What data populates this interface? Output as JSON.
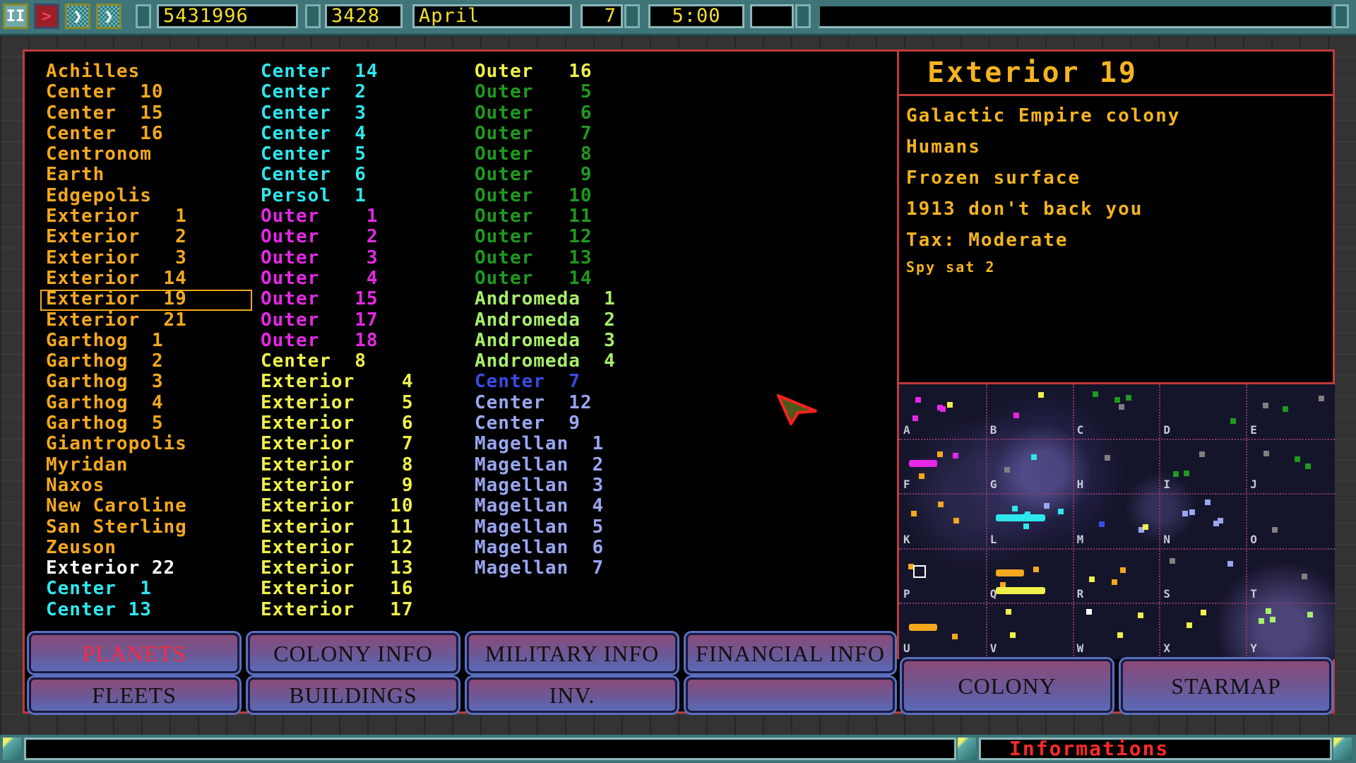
{
  "topbar": {
    "controls": [
      {
        "name": "pause",
        "glyph": "II"
      },
      {
        "name": "play",
        "glyph": ">"
      },
      {
        "name": "fast",
        "glyph": "❯"
      },
      {
        "name": "faster",
        "glyph": "❯"
      }
    ],
    "credits": "5431996",
    "population": "3428",
    "month": "April",
    "day": "7",
    "time": "5:00",
    "empty_field": "",
    "message": ""
  },
  "planet_list": {
    "selected": "Exterior 19",
    "columns": [
      [
        {
          "name": "Achilles",
          "color": "#f5a81e"
        },
        {
          "name": "Center  10",
          "color": "#f5a81e"
        },
        {
          "name": "Center  15",
          "color": "#f5a81e"
        },
        {
          "name": "Center  16",
          "color": "#f5a81e"
        },
        {
          "name": "Centronom",
          "color": "#f5a81e"
        },
        {
          "name": "Earth",
          "color": "#f5a81e"
        },
        {
          "name": "Edgepolis",
          "color": "#f5a81e"
        },
        {
          "name": "Exterior   1",
          "color": "#f5a81e"
        },
        {
          "name": "Exterior   2",
          "color": "#f5a81e"
        },
        {
          "name": "Exterior   3",
          "color": "#f5a81e"
        },
        {
          "name": "Exterior  14",
          "color": "#f5a81e"
        },
        {
          "name": "Exterior  19",
          "color": "#f5a81e",
          "selected": true
        },
        {
          "name": "Exterior  21",
          "color": "#f5a81e"
        },
        {
          "name": "Garthog  1",
          "color": "#f5a81e"
        },
        {
          "name": "Garthog  2",
          "color": "#f5a81e"
        },
        {
          "name": "Garthog  3",
          "color": "#f5a81e"
        },
        {
          "name": "Garthog  4",
          "color": "#f5a81e"
        },
        {
          "name": "Garthog  5",
          "color": "#f5a81e"
        },
        {
          "name": "Giantropolis",
          "color": "#f5a81e"
        },
        {
          "name": "Myridan",
          "color": "#f5a81e"
        },
        {
          "name": "Naxos",
          "color": "#f5a81e"
        },
        {
          "name": "New Caroline",
          "color": "#f5a81e"
        },
        {
          "name": "San Sterling",
          "color": "#f5a81e"
        },
        {
          "name": "Zeuson",
          "color": "#f5a81e"
        },
        {
          "name": "Exterior 22",
          "color": "#ffffff"
        },
        {
          "name": "Center  1",
          "color": "#2ee6ee"
        },
        {
          "name": "Center 13",
          "color": "#2ee6ee"
        }
      ],
      [
        {
          "name": "Center  14",
          "color": "#2ee6ee"
        },
        {
          "name": "Center  2",
          "color": "#2ee6ee"
        },
        {
          "name": "Center  3",
          "color": "#2ee6ee"
        },
        {
          "name": "Center  4",
          "color": "#2ee6ee"
        },
        {
          "name": "Center  5",
          "color": "#2ee6ee"
        },
        {
          "name": "Center  6",
          "color": "#2ee6ee"
        },
        {
          "name": "Persol  1",
          "color": "#2ee6ee"
        },
        {
          "name": "Outer    1",
          "color": "#e628e6"
        },
        {
          "name": "Outer    2",
          "color": "#e628e6"
        },
        {
          "name": "Outer    3",
          "color": "#e628e6"
        },
        {
          "name": "Outer    4",
          "color": "#e628e6"
        },
        {
          "name": "Outer   15",
          "color": "#e628e6"
        },
        {
          "name": "Outer   17",
          "color": "#e628e6"
        },
        {
          "name": "Outer   18",
          "color": "#e628e6"
        },
        {
          "name": "Center  8",
          "color": "#f0f04a"
        },
        {
          "name": "Exterior    4",
          "color": "#f0f04a"
        },
        {
          "name": "Exterior    5",
          "color": "#f0f04a"
        },
        {
          "name": "Exterior    6",
          "color": "#f0f04a"
        },
        {
          "name": "Exterior    7",
          "color": "#f0f04a"
        },
        {
          "name": "Exterior    8",
          "color": "#f0f04a"
        },
        {
          "name": "Exterior    9",
          "color": "#f0f04a"
        },
        {
          "name": "Exterior   10",
          "color": "#f0f04a"
        },
        {
          "name": "Exterior   11",
          "color": "#f0f04a"
        },
        {
          "name": "Exterior   12",
          "color": "#f0f04a"
        },
        {
          "name": "Exterior   13",
          "color": "#f0f04a"
        },
        {
          "name": "Exterior   16",
          "color": "#f0f04a"
        },
        {
          "name": "Exterior   17",
          "color": "#f0f04a"
        }
      ],
      [
        {
          "name": "Outer   16",
          "color": "#f0f04a"
        },
        {
          "name": "Outer    5",
          "color": "#1e9a1e"
        },
        {
          "name": "Outer    6",
          "color": "#1e9a1e"
        },
        {
          "name": "Outer    7",
          "color": "#1e9a1e"
        },
        {
          "name": "Outer    8",
          "color": "#1e9a1e"
        },
        {
          "name": "Outer    9",
          "color": "#1e9a1e"
        },
        {
          "name": "Outer   10",
          "color": "#1e9a1e"
        },
        {
          "name": "Outer   11",
          "color": "#1e9a1e"
        },
        {
          "name": "Outer   12",
          "color": "#1e9a1e"
        },
        {
          "name": "Outer   13",
          "color": "#1e9a1e"
        },
        {
          "name": "Outer   14",
          "color": "#1e9a1e"
        },
        {
          "name": "Andromeda  1",
          "color": "#a8f06a"
        },
        {
          "name": "Andromeda  2",
          "color": "#a8f06a"
        },
        {
          "name": "Andromeda  3",
          "color": "#a8f06a"
        },
        {
          "name": "Andromeda  4",
          "color": "#a8f06a"
        },
        {
          "name": "Center  7",
          "color": "#3a4ae6"
        },
        {
          "name": "Center  12",
          "color": "#9aa6f0"
        },
        {
          "name": "Center  9",
          "color": "#9aa6f0"
        },
        {
          "name": "Magellan  1",
          "color": "#9aa6f0"
        },
        {
          "name": "Magellan  2",
          "color": "#9aa6f0"
        },
        {
          "name": "Magellan  3",
          "color": "#9aa6f0"
        },
        {
          "name": "Magellan  4",
          "color": "#9aa6f0"
        },
        {
          "name": "Magellan  5",
          "color": "#9aa6f0"
        },
        {
          "name": "Magellan  6",
          "color": "#9aa6f0"
        },
        {
          "name": "Magellan  7",
          "color": "#9aa6f0"
        }
      ]
    ]
  },
  "info_panel": {
    "title": "Exterior 19",
    "lines": [
      "Galactic Empire colony",
      "Humans",
      "Frozen surface",
      "1913 don't back you",
      "Tax: Moderate"
    ],
    "small_line": "Spy sat 2"
  },
  "starmap": {
    "sectors": [
      "A",
      "B",
      "C",
      "D",
      "E",
      "F",
      "G",
      "H",
      "I",
      "J",
      "K",
      "L",
      "M",
      "N",
      "O",
      "P",
      "Q",
      "R",
      "S",
      "T",
      "U",
      "V",
      "W",
      "X",
      "Y"
    ],
    "stars": [
      {
        "sector": "A",
        "color": "#e628e6"
      },
      {
        "sector": "A",
        "color": "#e628e6"
      },
      {
        "sector": "A",
        "color": "#e628e6"
      },
      {
        "sector": "A",
        "color": "#e628e6"
      },
      {
        "sector": "A",
        "color": "#f0f04a"
      },
      {
        "sector": "B",
        "color": "#e628e6"
      },
      {
        "sector": "B",
        "color": "#f0f04a"
      },
      {
        "sector": "C",
        "color": "#1e9a1e"
      },
      {
        "sector": "C",
        "color": "#1e9a1e"
      },
      {
        "sector": "C",
        "color": "#808080"
      },
      {
        "sector": "C",
        "color": "#1e9a1e"
      },
      {
        "sector": "D",
        "color": "#1e9a1e"
      },
      {
        "sector": "E",
        "color": "#808080"
      },
      {
        "sector": "E",
        "color": "#808080"
      },
      {
        "sector": "E",
        "color": "#1e9a1e"
      },
      {
        "sector": "F",
        "color": "#e628e6"
      },
      {
        "sector": "F",
        "color": "#f5a81e"
      },
      {
        "sector": "F",
        "color": "#f5a81e"
      },
      {
        "sector": "G",
        "color": "#2ee6ee"
      },
      {
        "sector": "G",
        "color": "#808080"
      },
      {
        "sector": "H",
        "color": "#808080"
      },
      {
        "sector": "I",
        "color": "#1e9a1e"
      },
      {
        "sector": "I",
        "color": "#1e9a1e"
      },
      {
        "sector": "I",
        "color": "#808080"
      },
      {
        "sector": "J",
        "color": "#1e9a1e"
      },
      {
        "sector": "J",
        "color": "#1e9a1e"
      },
      {
        "sector": "J",
        "color": "#808080"
      },
      {
        "sector": "K",
        "color": "#f5a81e"
      },
      {
        "sector": "K",
        "color": "#f5a81e"
      },
      {
        "sector": "K",
        "color": "#f5a81e"
      },
      {
        "sector": "L",
        "color": "#2ee6ee"
      },
      {
        "sector": "L",
        "color": "#2ee6ee"
      },
      {
        "sector": "L",
        "color": "#2ee6ee"
      },
      {
        "sector": "L",
        "color": "#2ee6ee"
      },
      {
        "sector": "L",
        "color": "#2ee6ee"
      },
      {
        "sector": "L",
        "color": "#9aa6f0"
      },
      {
        "sector": "M",
        "color": "#3a4ae6"
      },
      {
        "sector": "M",
        "color": "#9aa6f0"
      },
      {
        "sector": "M",
        "color": "#f0f04a"
      },
      {
        "sector": "N",
        "color": "#9aa6f0"
      },
      {
        "sector": "N",
        "color": "#9aa6f0"
      },
      {
        "sector": "N",
        "color": "#9aa6f0"
      },
      {
        "sector": "N",
        "color": "#9aa6f0"
      },
      {
        "sector": "N",
        "color": "#9aa6f0"
      },
      {
        "sector": "O",
        "color": "#808080"
      },
      {
        "sector": "P",
        "color": "#f5a81e"
      },
      {
        "sector": "Q",
        "color": "#f5a81e"
      },
      {
        "sector": "Q",
        "color": "#f5a81e"
      },
      {
        "sector": "R",
        "color": "#f5a81e"
      },
      {
        "sector": "R",
        "color": "#f5a81e"
      },
      {
        "sector": "R",
        "color": "#f0f04a"
      },
      {
        "sector": "S",
        "color": "#9aa6f0"
      },
      {
        "sector": "S",
        "color": "#808080"
      },
      {
        "sector": "T",
        "color": "#808080"
      },
      {
        "sector": "U",
        "color": "#f5a81e"
      },
      {
        "sector": "V",
        "color": "#f0f04a"
      },
      {
        "sector": "V",
        "color": "#f0f04a"
      },
      {
        "sector": "W",
        "color": "#ffffff"
      },
      {
        "sector": "W",
        "color": "#f0f04a"
      },
      {
        "sector": "W",
        "color": "#f0f04a"
      },
      {
        "sector": "X",
        "color": "#f0f04a"
      },
      {
        "sector": "X",
        "color": "#f0f04a"
      },
      {
        "sector": "Y",
        "color": "#a8f06a"
      },
      {
        "sector": "Y",
        "color": "#a8f06a"
      },
      {
        "sector": "Y",
        "color": "#a8f06a"
      },
      {
        "sector": "Y",
        "color": "#a8f06a"
      }
    ],
    "fleets": [
      {
        "sector": "F",
        "color": "#e628e6"
      },
      {
        "sector": "L",
        "color": "#2ee6ee"
      },
      {
        "sector": "Q",
        "color": "#f5a81e"
      },
      {
        "sector": "Q",
        "color": "#f0f04a"
      },
      {
        "sector": "U",
        "color": "#f5a81e"
      }
    ],
    "selected_sector": "P"
  },
  "tabs": {
    "row1": [
      "PLANETS",
      "COLONY INFO",
      "MILITARY INFO",
      "FINANCIAL INFO"
    ],
    "row2": [
      "FLEETS",
      "BUILDINGS",
      "INV.",
      ""
    ],
    "active": "PLANETS"
  },
  "nav_buttons": [
    "COLONY",
    "STARMAP"
  ],
  "status_bar": {
    "left_text": "",
    "right_text": "Informations",
    "right_text_color": "#ff2a2a"
  }
}
